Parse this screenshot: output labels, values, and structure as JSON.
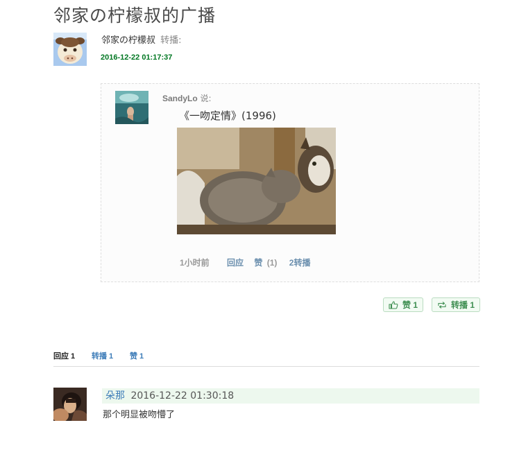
{
  "page": {
    "title": "邻家の柠檬叔的广播"
  },
  "post": {
    "author": "邻家の柠檬叔",
    "action": "转播:",
    "time": "2016-12-22 01:17:37"
  },
  "reshare": {
    "author": "SandyLo",
    "says": "说:",
    "text": "《一吻定情》(1996)",
    "time_ago": "1小时前",
    "reply_label": "回应",
    "like_label": "赞",
    "like_count": "(1)",
    "reshare_label": "2转播"
  },
  "buttons": {
    "like": "赞 1",
    "reshare": "转播 1"
  },
  "tabs": {
    "replies": "回应 1",
    "reshares": "转播 1",
    "likes": "赞 1"
  },
  "comment": {
    "user": "朵那",
    "time": "2016-12-22 01:30:18",
    "text": "那个明显被吻懵了"
  },
  "colors": {
    "time_green": "#007722",
    "link_blue": "#3d7cb8",
    "button_green": "#3f8f52",
    "comment_bg": "#edf8ee"
  },
  "icons": [
    "thumbs-up-icon",
    "reshare-icon"
  ]
}
